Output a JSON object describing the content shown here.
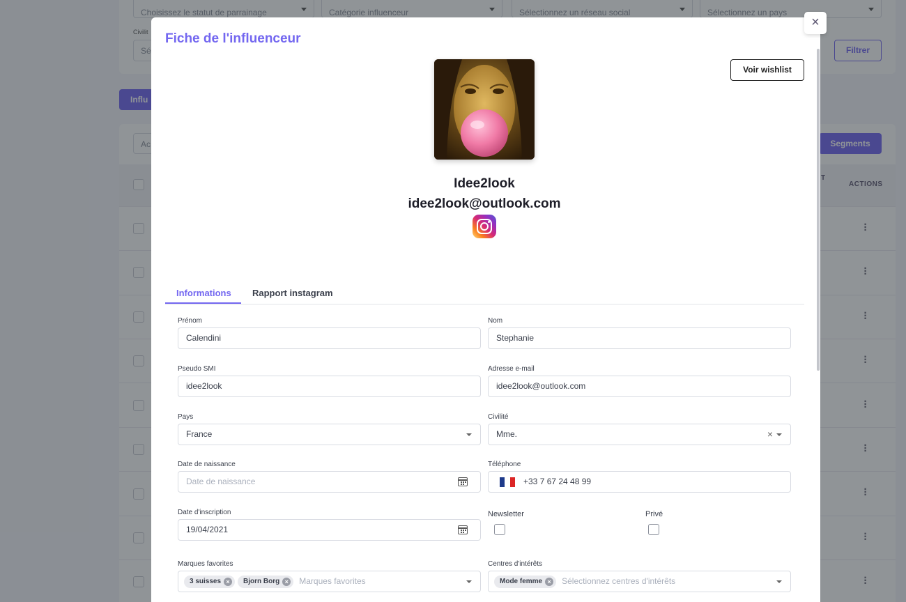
{
  "background": {
    "filters": {
      "parrainage_placeholder": "Choisissez le statut de parrainage",
      "categorie_placeholder": "Catégorie influenceur",
      "reseau_placeholder": "Sélectionnez un réseau social",
      "pays_placeholder": "Sélectionnez un pays",
      "civilite_label": "Civilit",
      "civilite_placeholder": "Sé",
      "filter_button": "Filtrer"
    },
    "influencer_tab": "Influ",
    "actions_input_placeholder": "Ac",
    "segments_button": "Segments",
    "table": {
      "actions_header": "ACTIONS",
      "partial_header": "T",
      "row_count": 9
    }
  },
  "modal": {
    "title": "Fiche de l'influenceur",
    "wishlist_button": "Voir wishlist",
    "profile": {
      "name": "Idee2look",
      "email": "idee2look@outlook.com",
      "social_icon": "instagram-icon"
    },
    "tabs": [
      {
        "label": "Informations",
        "active": true
      },
      {
        "label": "Rapport instagram",
        "active": false
      }
    ],
    "form": {
      "prenom": {
        "label": "Prénom",
        "value": "Calendini"
      },
      "nom": {
        "label": "Nom",
        "value": "Stephanie"
      },
      "pseudo": {
        "label": "Pseudo SMI",
        "value": "idee2look"
      },
      "email": {
        "label": "Adresse e-mail",
        "value": "idee2look@outlook.com"
      },
      "pays": {
        "label": "Pays",
        "value": "France"
      },
      "civilite": {
        "label": "Civilité",
        "value": "Mme."
      },
      "date_naissance": {
        "label": "Date de naissance",
        "placeholder": "Date de naissance"
      },
      "telephone": {
        "label": "Téléphone",
        "value": "+33 7 67 24 48 99",
        "flag": "fr"
      },
      "date_inscription": {
        "label": "Date d'inscription",
        "value": "19/04/2021"
      },
      "newsletter": {
        "label": "Newsletter",
        "checked": false
      },
      "prive": {
        "label": "Privé",
        "checked": false
      },
      "marques": {
        "label": "Marques favorites",
        "tags": [
          "3 suisses",
          "Bjorn Borg"
        ],
        "placeholder": "Marques favorites"
      },
      "centres": {
        "label": "Centres d'intérêts",
        "tags": [
          "Mode femme"
        ],
        "placeholder": "Sélectionnez centres d'intérêts"
      }
    }
  },
  "colors": {
    "accent": "#7367f0",
    "overlay": "rgba(34,41,47,0.5)"
  }
}
